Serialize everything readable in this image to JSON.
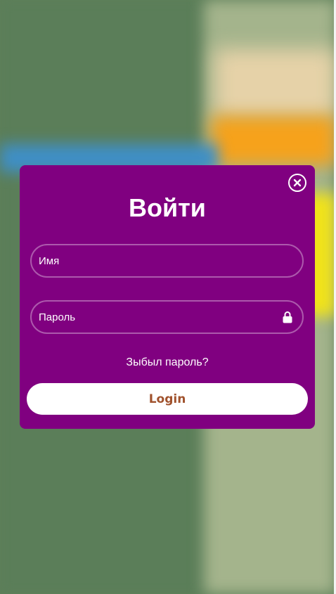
{
  "modal": {
    "title": "Войти",
    "close_icon": "close-circle-icon",
    "name_field": {
      "placeholder": "Имя",
      "value": ""
    },
    "password_field": {
      "placeholder": "Пароль",
      "value": "",
      "icon": "lock-icon"
    },
    "forgot_link": "Зыбыл пароль?",
    "login_label": "Login"
  },
  "colors": {
    "modal_background": "#800080",
    "login_text": "#a0522d",
    "text": "#ffffff"
  }
}
